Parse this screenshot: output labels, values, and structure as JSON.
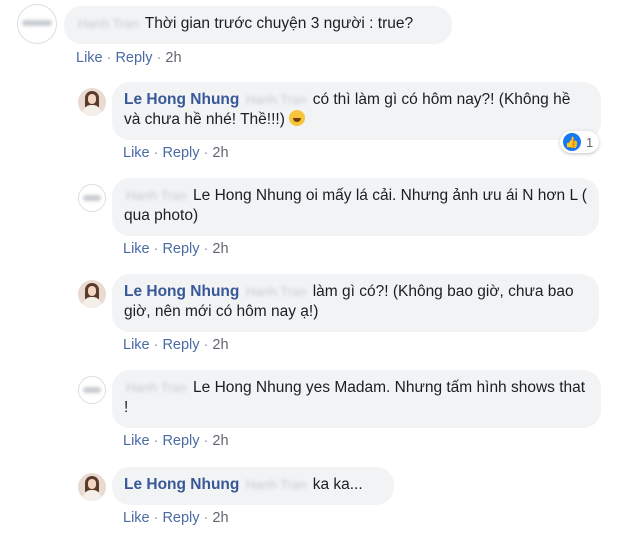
{
  "actions": {
    "like": "Like",
    "reply": "Reply",
    "separator": "·",
    "time": "2h"
  },
  "comments": [
    {
      "author": "",
      "tag": "Hanh Tran",
      "text": "Thời gian trước chuyện 3 người : true?"
    },
    {
      "author": "Le Hong Nhung",
      "tag": "Hanh Tran",
      "text": "có thì làm gì có hôm nay?! (Không hề và chưa hề nhé! Thề!!!)",
      "reaction_count": "1"
    },
    {
      "author": "",
      "tag": "Hanh Tran",
      "text": "Le Hong Nhung oi mấy lá cải. Nhưng ảnh ưu ái N hơn L ( qua photo)"
    },
    {
      "author": "Le Hong Nhung",
      "tag": "Hanh Tran",
      "text": "làm gì có?! (Không bao giờ, chưa bao giờ, nên mới có hôm nay ạ!)"
    },
    {
      "author": "",
      "tag": "Hanh Tran",
      "text": "Le Hong Nhung yes Madam. Nhưng tấm hình shows that !"
    },
    {
      "author": "Le Hong Nhung",
      "tag": "Hanh Tran",
      "text": "ka ka..."
    }
  ],
  "icons": {
    "like_reaction": "thumbs-up-icon",
    "emoji": "laughing-emoji-icon"
  },
  "colors": {
    "author": "#385898",
    "link": "#4b6aa5",
    "bubble": "#f2f3f5",
    "like_blue": "#1877f2"
  }
}
